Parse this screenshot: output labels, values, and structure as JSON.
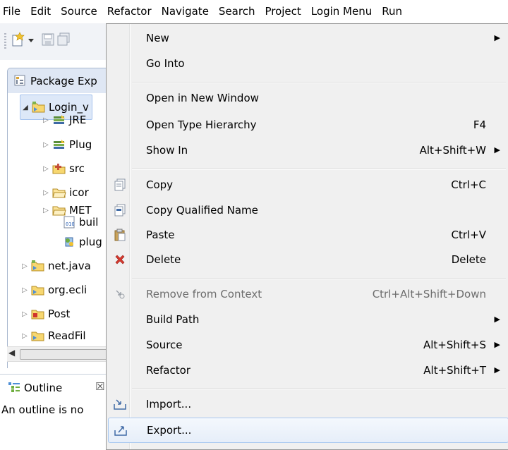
{
  "menubar": {
    "items": [
      "File",
      "Edit",
      "Source",
      "Refactor",
      "Navigate",
      "Search",
      "Project",
      "Login Menu",
      "Run"
    ]
  },
  "package_explorer": {
    "tab_label": "Package Exp",
    "tree": [
      {
        "label": "Login_v",
        "twisty": "◢",
        "icon": "project-icon"
      },
      {
        "label": "JRE",
        "twisty": "▷",
        "icon": "library-icon"
      },
      {
        "label": "Plug",
        "twisty": "▷",
        "icon": "library-icon"
      },
      {
        "label": "src",
        "twisty": "▷",
        "icon": "source-folder-icon"
      },
      {
        "label": "icor",
        "twisty": "▷",
        "icon": "folder-icon"
      },
      {
        "label": "MET",
        "twisty": "▷",
        "icon": "folder-icon"
      },
      {
        "label": "buil",
        "twisty": "",
        "icon": "file-icon"
      },
      {
        "label": "plug",
        "twisty": "",
        "icon": "plugin-file-icon"
      },
      {
        "label": "net.java",
        "twisty": "▷",
        "icon": "project-icon"
      },
      {
        "label": "org.ecli",
        "twisty": "▷",
        "icon": "project-icon"
      },
      {
        "label": "Post",
        "twisty": "▷",
        "icon": "project-icon"
      },
      {
        "label": "ReadFil",
        "twisty": "▷",
        "icon": "project-icon"
      }
    ]
  },
  "outline": {
    "tab_label": "Outline",
    "close_glyph": "☒",
    "message": "An outline is no"
  },
  "context_menu": {
    "items": [
      {
        "label": "New",
        "shortcut": "",
        "submenu": true
      },
      {
        "label": "Go Into",
        "shortcut": "",
        "submenu": false
      },
      {
        "label": "Open in New Window",
        "shortcut": "",
        "submenu": false
      },
      {
        "label": "Open Type Hierarchy",
        "shortcut": "F4",
        "submenu": false
      },
      {
        "label": "Show In",
        "shortcut": "Alt+Shift+W",
        "submenu": true
      },
      {
        "label": "Copy",
        "shortcut": "Ctrl+C",
        "submenu": false
      },
      {
        "label": "Copy Qualified Name",
        "shortcut": "",
        "submenu": false
      },
      {
        "label": "Paste",
        "shortcut": "Ctrl+V",
        "submenu": false
      },
      {
        "label": "Delete",
        "shortcut": "Delete",
        "submenu": false
      },
      {
        "label": "Remove from Context",
        "shortcut": "Ctrl+Alt+Shift+Down",
        "submenu": false,
        "disabled": true
      },
      {
        "label": "Build Path",
        "shortcut": "",
        "submenu": true
      },
      {
        "label": "Source",
        "shortcut": "Alt+Shift+S",
        "submenu": true
      },
      {
        "label": "Refactor",
        "shortcut": "Alt+Shift+T",
        "submenu": true
      },
      {
        "label": "Import...",
        "shortcut": "",
        "submenu": false
      },
      {
        "label": "Export...",
        "shortcut": "",
        "submenu": false,
        "highlighted": true
      }
    ],
    "arrow_glyph": "▶"
  }
}
